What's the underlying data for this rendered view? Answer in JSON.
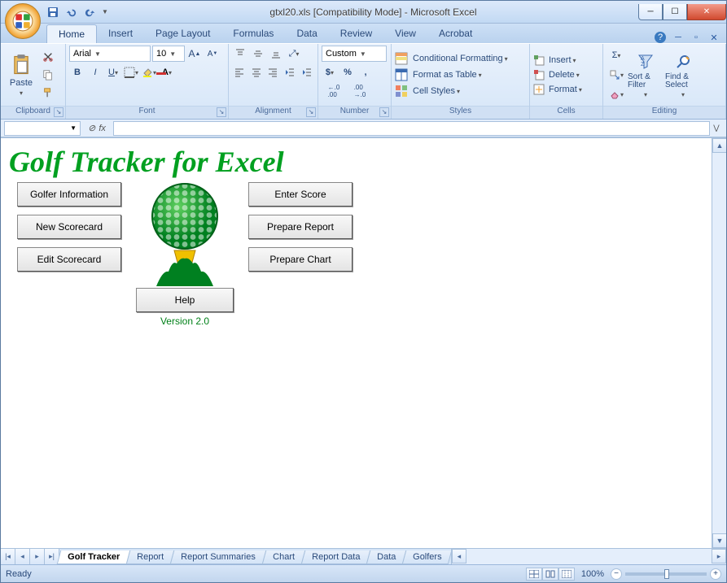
{
  "window": {
    "title": "gtxl20.xls  [Compatibility Mode] - Microsoft Excel"
  },
  "tabs": {
    "items": [
      "Home",
      "Insert",
      "Page Layout",
      "Formulas",
      "Data",
      "Review",
      "View",
      "Acrobat"
    ],
    "active": "Home"
  },
  "ribbon": {
    "clipboard": {
      "label": "Clipboard",
      "paste": "Paste"
    },
    "font": {
      "label": "Font",
      "name": "Arial",
      "size": "10"
    },
    "alignment": {
      "label": "Alignment"
    },
    "number": {
      "label": "Number",
      "format": "Custom",
      "currency": "$",
      "percent": "%",
      "comma": ",",
      "inc": ".0 .00",
      "dec": ".00 .0"
    },
    "styles": {
      "label": "Styles",
      "conditional": "Conditional Formatting",
      "table": "Format as Table",
      "cell": "Cell Styles"
    },
    "cells": {
      "label": "Cells",
      "insert": "Insert",
      "delete": "Delete",
      "format": "Format"
    },
    "editing": {
      "label": "Editing",
      "sort": "Sort & Filter",
      "find": "Find & Select"
    }
  },
  "formula_bar": {
    "namebox": "",
    "fx": "fx"
  },
  "golf": {
    "title": "Golf Tracker for Excel",
    "buttons_left": [
      "Golfer Information",
      "New Scorecard",
      "Edit Scorecard"
    ],
    "buttons_right": [
      "Enter Score",
      "Prepare Report",
      "Prepare Chart"
    ],
    "help": "Help",
    "version": "Version 2.0"
  },
  "sheet_tabs": [
    "Golf Tracker",
    "Report",
    "Report Summaries",
    "Chart",
    "Report Data",
    "Data",
    "Golfers"
  ],
  "sheet_tab_active": "Golf Tracker",
  "status": {
    "ready": "Ready",
    "zoom": "100%"
  }
}
